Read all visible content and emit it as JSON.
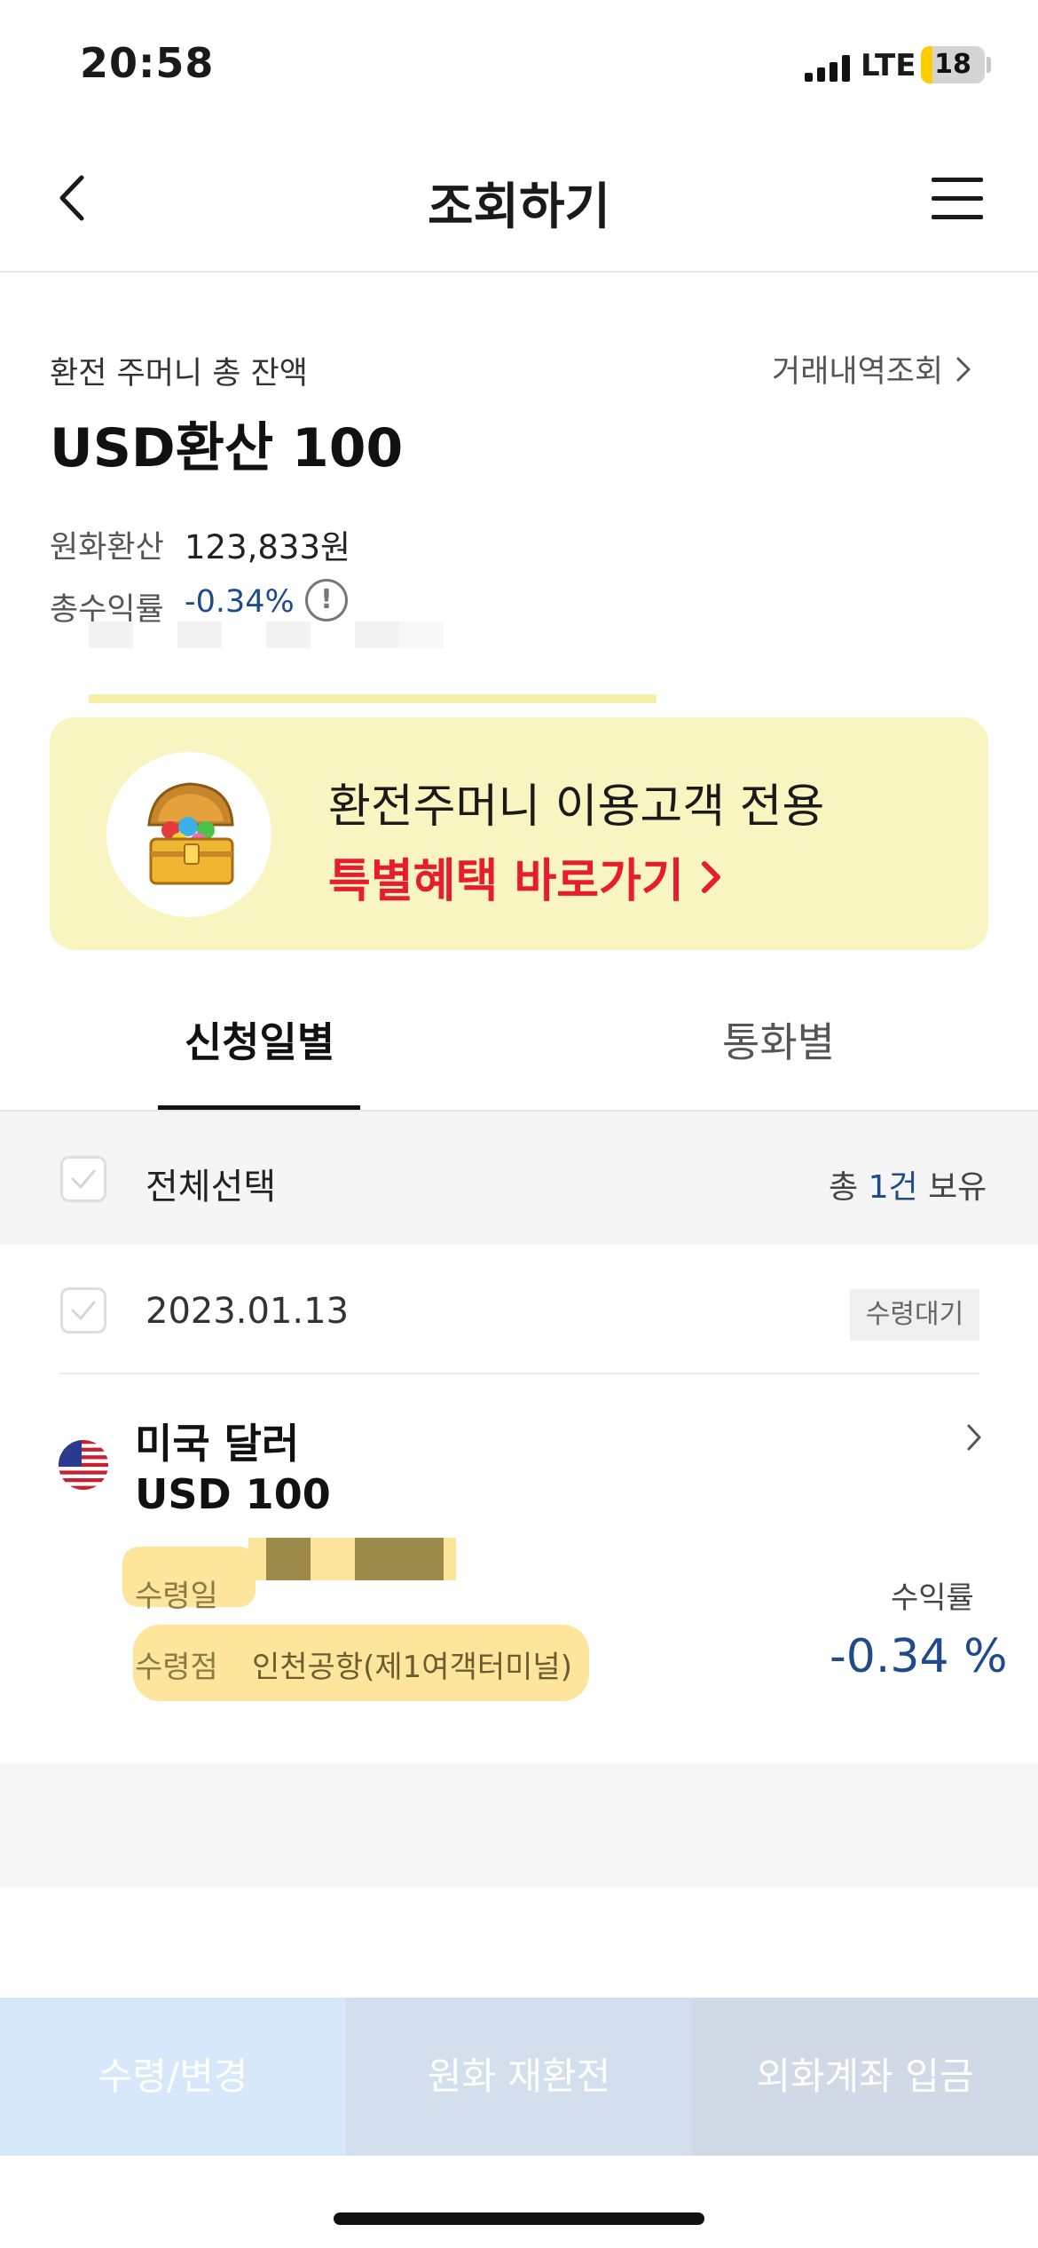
{
  "status_bar": {
    "time": "20:58",
    "network": "LTE",
    "battery": "18",
    "battery_level_pct": 18
  },
  "header": {
    "title": "조회하기",
    "back_icon": "chevron-left-icon",
    "menu_icon": "hamburger-menu-icon"
  },
  "balance": {
    "label": "환전 주머니 총 잔액",
    "history_link": "거래내역조회",
    "main": "USD환산 100",
    "krw_label": "원화환산",
    "krw_value": "123,833원",
    "rate_label": "총수익률",
    "rate_value": "-0.34%",
    "info_icon": "!"
  },
  "banner": {
    "line1": "환전주머니 이용고객 전용",
    "line2": "특별혜택 바로가기",
    "icon": "treasure-chest-icon"
  },
  "tabs": [
    {
      "label": "신청일별",
      "active": true
    },
    {
      "label": "통화별",
      "active": false
    }
  ],
  "select_all": {
    "label": "전체선택",
    "count_prefix": "총",
    "count_num": "1건",
    "count_suffix": "보유"
  },
  "item": {
    "date": "2023.01.13",
    "status": "수령대기",
    "currency_name": "미국 달러",
    "amount": "USD 100",
    "receive_date_label": "수령일",
    "receive_place_label": "수령점",
    "receive_place_value": "인천공항(제1여객터미널)",
    "rate_label": "수익률",
    "rate_value": "-0.34 %"
  },
  "bottom_buttons": [
    "수령/변경",
    "원화 재환전",
    "외화계좌 입금"
  ],
  "colors": {
    "accent_blue": "#1f4a8c",
    "promo_red": "#e81c2d",
    "banner_bg": "#f8f5c0"
  }
}
